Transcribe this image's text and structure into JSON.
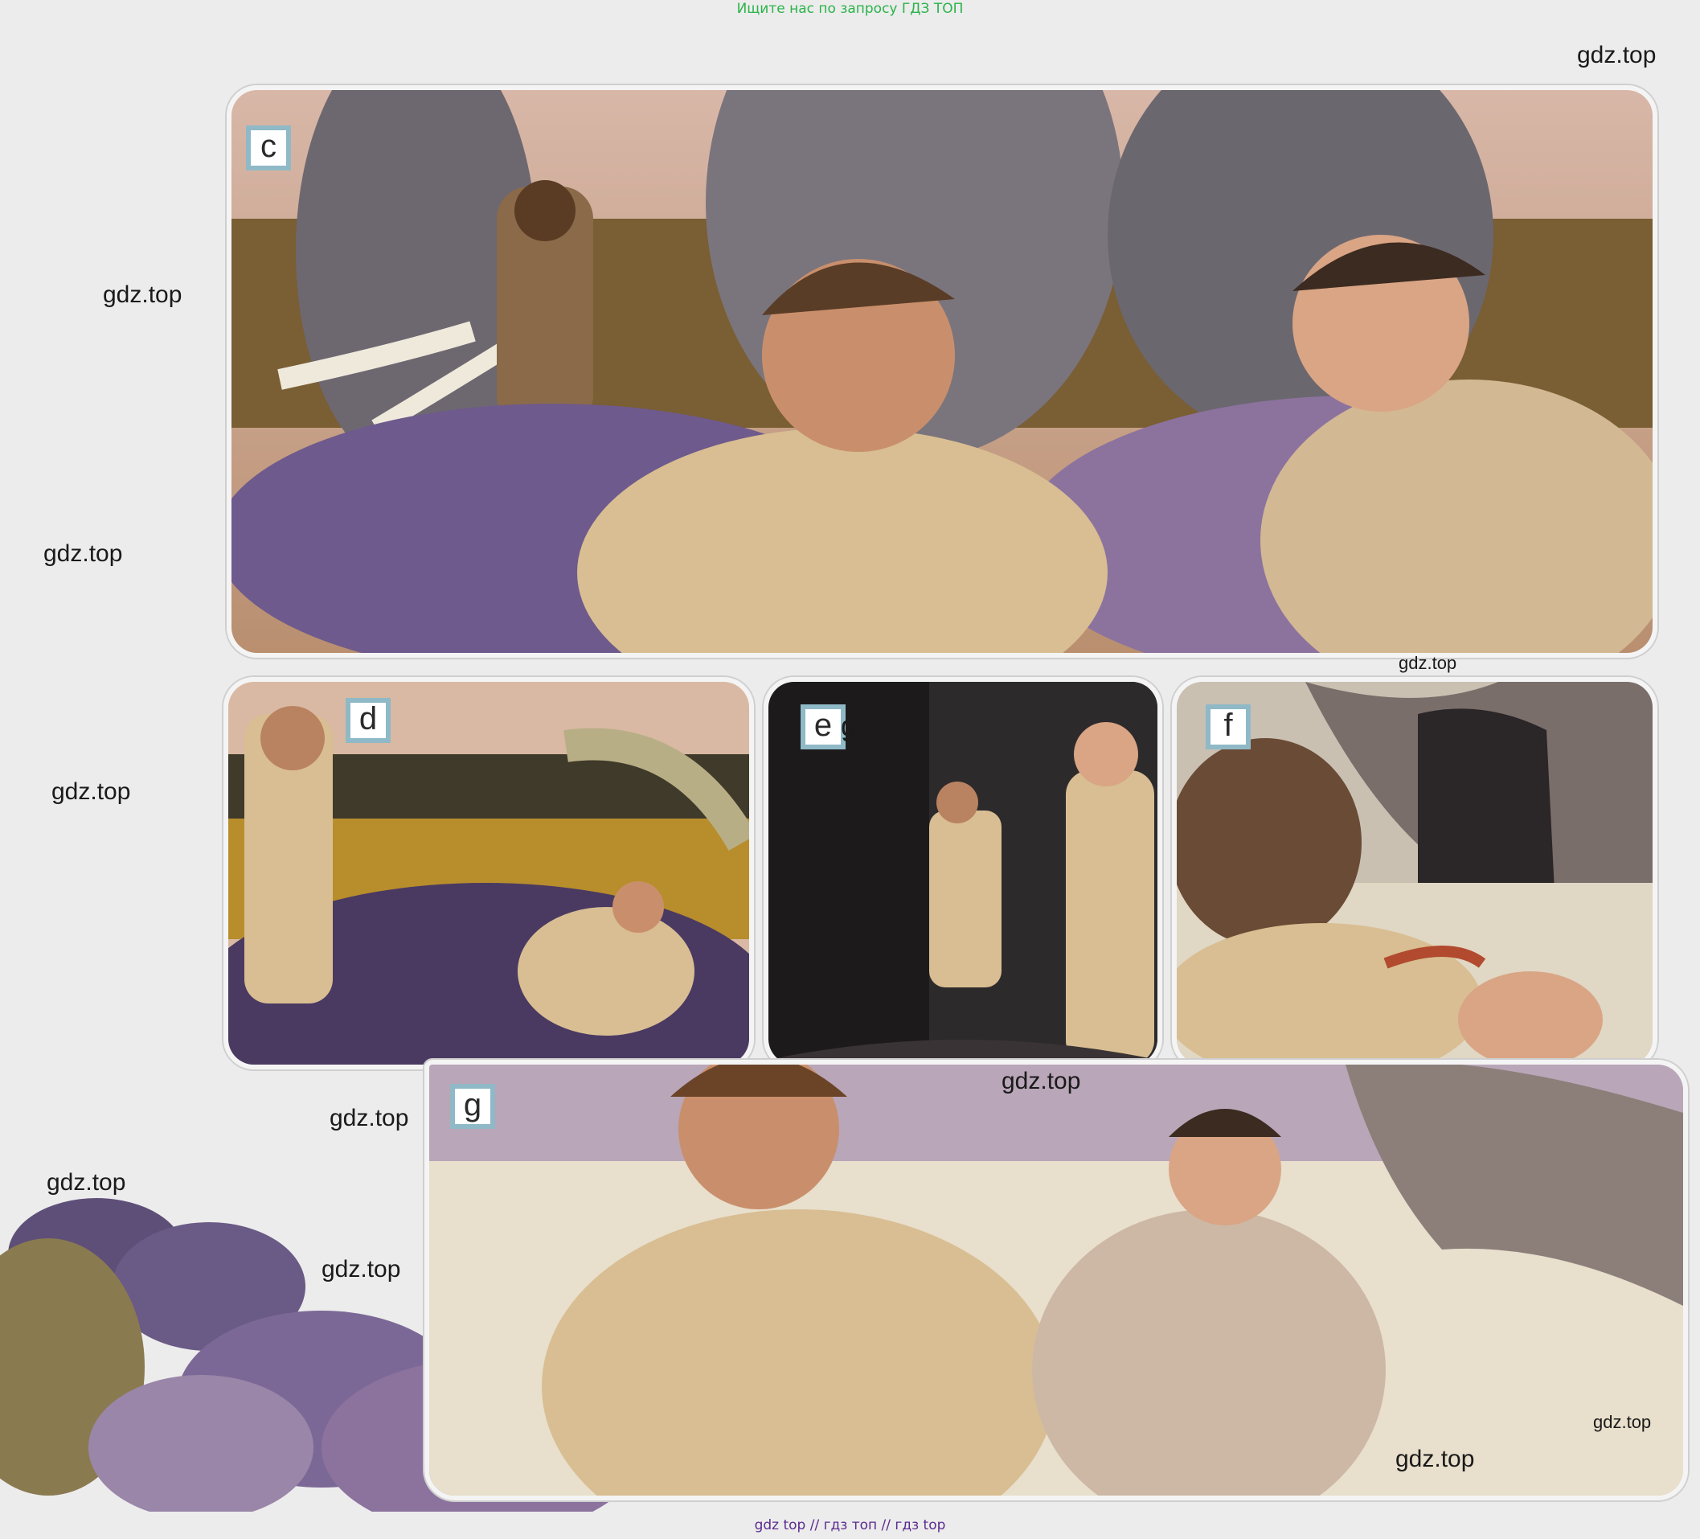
{
  "banner": "Ищите нас по запросу ГДЗ ТОП",
  "footer": "gdz top  //  гдз топ  //  гдз top",
  "panels": {
    "c": "c",
    "d": "d",
    "e": "e",
    "f": "f",
    "g": "g"
  },
  "panel_e_extra": "g",
  "watermark": "gdz.top",
  "colors": {
    "banner": "#2bb34a",
    "footer": "#5b2b8f",
    "label_border": "#8fb9c7",
    "leaves": "#6e5a8c",
    "jacket": "#d8be92"
  }
}
